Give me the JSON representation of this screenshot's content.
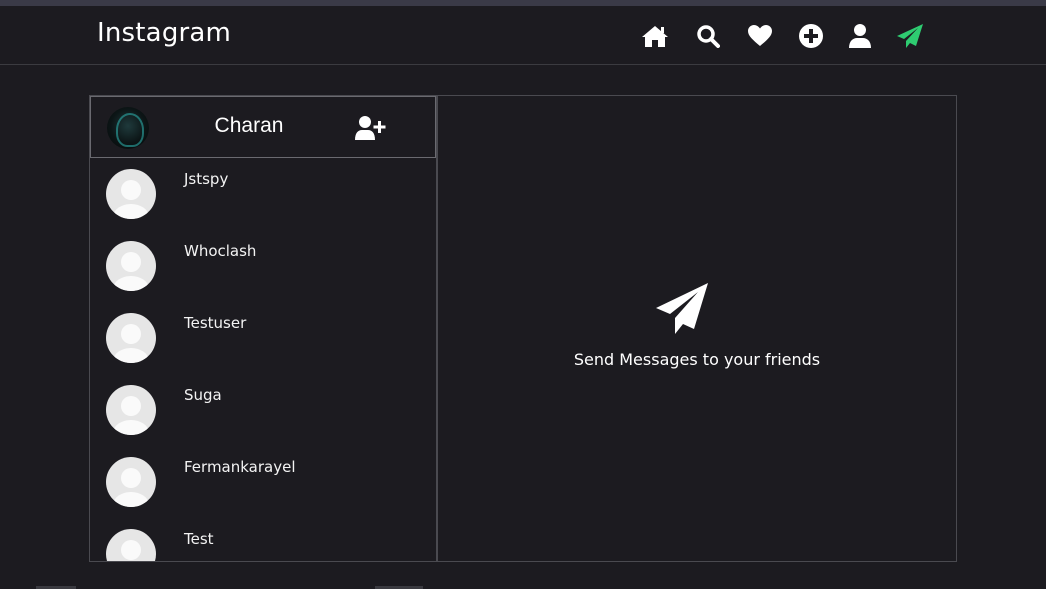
{
  "app": {
    "title": "Instagram"
  },
  "nav": {
    "items": [
      {
        "icon": "home-icon"
      },
      {
        "icon": "search-icon"
      },
      {
        "icon": "heart-icon"
      },
      {
        "icon": "plus-circle-icon"
      },
      {
        "icon": "user-icon"
      },
      {
        "icon": "paper-plane-icon",
        "active": true
      }
    ],
    "active_color": "#2ecc71"
  },
  "sidebar": {
    "current_user": "Charan",
    "add_user_icon": "user-plus-icon",
    "users": [
      {
        "name": "Jstspy"
      },
      {
        "name": "Whoclash"
      },
      {
        "name": "Testuser"
      },
      {
        "name": "Suga"
      },
      {
        "name": "Fermankarayel"
      },
      {
        "name": "Test"
      }
    ]
  },
  "chat": {
    "empty_icon": "paper-plane-icon",
    "empty_text": "Send Messages to your friends"
  },
  "colors": {
    "background": "#1c1b20",
    "border": "#4a4a50",
    "text": "#ffffff",
    "accent": "#2ecc71"
  }
}
